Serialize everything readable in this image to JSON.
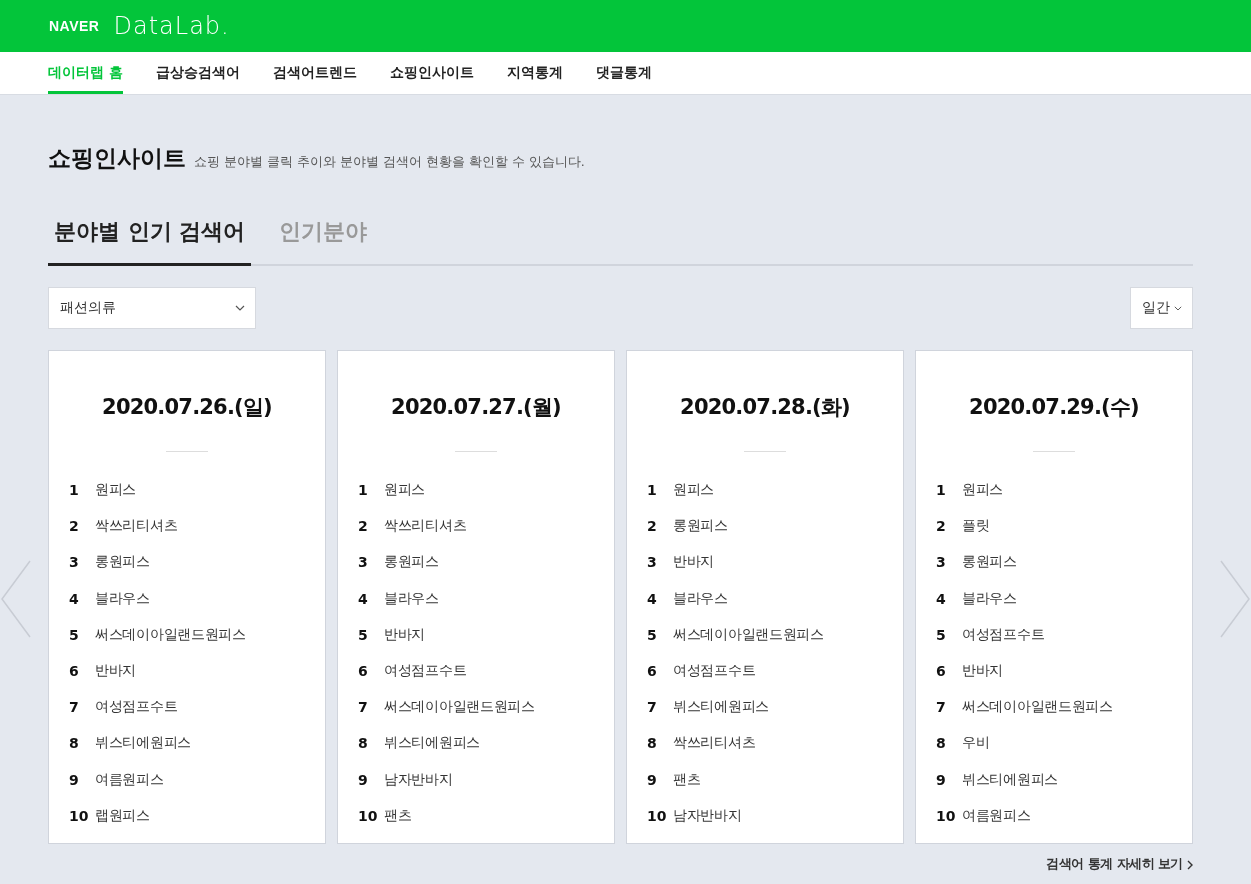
{
  "header": {
    "brand": "NAVER",
    "product": "DataLab."
  },
  "nav": [
    {
      "label": "데이터랩 홈",
      "selected": true
    },
    {
      "label": "급상승검색어",
      "selected": false
    },
    {
      "label": "검색어트렌드",
      "selected": false
    },
    {
      "label": "쇼핑인사이트",
      "selected": false
    },
    {
      "label": "지역통계",
      "selected": false
    },
    {
      "label": "댓글통계",
      "selected": false
    }
  ],
  "page": {
    "title": "쇼핑인사이트",
    "description": "쇼핑 분야별 클릭 추이와 분야별 검색어 현황을 확인할 수 있습니다."
  },
  "tabs": [
    {
      "label": "분야별 인기 검색어",
      "selected": true
    },
    {
      "label": "인기분야",
      "selected": false
    }
  ],
  "category_select": {
    "value": "패션의류"
  },
  "period_select": {
    "value": "일간"
  },
  "cards": [
    {
      "date": "2020.07.26.(일)",
      "keywords": [
        {
          "rank": "1",
          "term": "원피스"
        },
        {
          "rank": "2",
          "term": "싹쓰리티셔츠"
        },
        {
          "rank": "3",
          "term": "롱원피스"
        },
        {
          "rank": "4",
          "term": "블라우스"
        },
        {
          "rank": "5",
          "term": "써스데이아일랜드원피스"
        },
        {
          "rank": "6",
          "term": "반바지"
        },
        {
          "rank": "7",
          "term": "여성점프수트"
        },
        {
          "rank": "8",
          "term": "뷔스티에원피스"
        },
        {
          "rank": "9",
          "term": "여름원피스"
        },
        {
          "rank": "10",
          "term": "랩원피스"
        }
      ]
    },
    {
      "date": "2020.07.27.(월)",
      "keywords": [
        {
          "rank": "1",
          "term": "원피스"
        },
        {
          "rank": "2",
          "term": "싹쓰리티셔츠"
        },
        {
          "rank": "3",
          "term": "롱원피스"
        },
        {
          "rank": "4",
          "term": "블라우스"
        },
        {
          "rank": "5",
          "term": "반바지"
        },
        {
          "rank": "6",
          "term": "여성점프수트"
        },
        {
          "rank": "7",
          "term": "써스데이아일랜드원피스"
        },
        {
          "rank": "8",
          "term": "뷔스티에원피스"
        },
        {
          "rank": "9",
          "term": "남자반바지"
        },
        {
          "rank": "10",
          "term": "팬츠"
        }
      ]
    },
    {
      "date": "2020.07.28.(화)",
      "keywords": [
        {
          "rank": "1",
          "term": "원피스"
        },
        {
          "rank": "2",
          "term": "롱원피스"
        },
        {
          "rank": "3",
          "term": "반바지"
        },
        {
          "rank": "4",
          "term": "블라우스"
        },
        {
          "rank": "5",
          "term": "써스데이아일랜드원피스"
        },
        {
          "rank": "6",
          "term": "여성점프수트"
        },
        {
          "rank": "7",
          "term": "뷔스티에원피스"
        },
        {
          "rank": "8",
          "term": "싹쓰리티셔츠"
        },
        {
          "rank": "9",
          "term": "팬츠"
        },
        {
          "rank": "10",
          "term": "남자반바지"
        }
      ]
    },
    {
      "date": "2020.07.29.(수)",
      "keywords": [
        {
          "rank": "1",
          "term": "원피스"
        },
        {
          "rank": "2",
          "term": "플릿"
        },
        {
          "rank": "3",
          "term": "롱원피스"
        },
        {
          "rank": "4",
          "term": "블라우스"
        },
        {
          "rank": "5",
          "term": "여성점프수트"
        },
        {
          "rank": "6",
          "term": "반바지"
        },
        {
          "rank": "7",
          "term": "써스데이아일랜드원피스"
        },
        {
          "rank": "8",
          "term": "우비"
        },
        {
          "rank": "9",
          "term": "뷔스티에원피스"
        },
        {
          "rank": "10",
          "term": "여름원피스"
        }
      ]
    }
  ],
  "more_link": "검색어 통계 자세히 보기"
}
